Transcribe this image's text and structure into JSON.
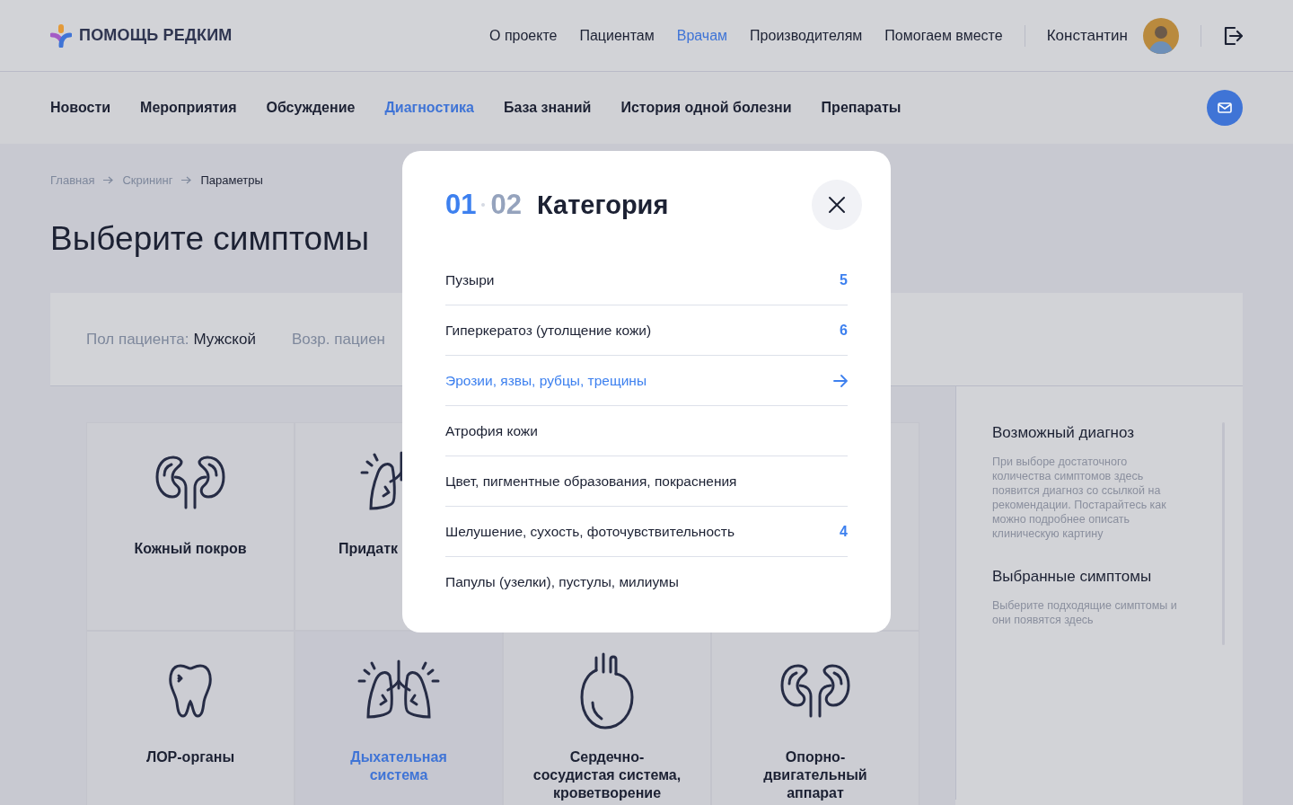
{
  "header": {
    "logo": "ПОМОЩЬ РЕДКИМ",
    "links": [
      {
        "label": "О проекте",
        "selected": false
      },
      {
        "label": "Пациентам",
        "selected": false
      },
      {
        "label": "Врачам",
        "selected": true
      },
      {
        "label": "Производителям",
        "selected": false
      },
      {
        "label": "Помогаем вместе",
        "selected": false
      }
    ],
    "user": "Константин"
  },
  "tabs": [
    {
      "label": "Новости",
      "selected": false
    },
    {
      "label": "Мероприятия",
      "selected": false
    },
    {
      "label": "Обсуждение",
      "selected": false
    },
    {
      "label": "Диагностика",
      "selected": true
    },
    {
      "label": "База знаний",
      "selected": false
    },
    {
      "label": "История одной болезни",
      "selected": false
    },
    {
      "label": "Препараты",
      "selected": false
    }
  ],
  "breadcrumbs": [
    "Главная",
    "Скрининг",
    "Параметры"
  ],
  "title": "Выберите симптомы",
  "filters": [
    {
      "label": "Пол пациента:",
      "value": "Мужской"
    },
    {
      "label": "Возр. пациен"
    }
  ],
  "categories": [
    [
      {
        "label": "Кожный покров",
        "kind": "kidneys",
        "selected": false
      },
      {
        "label": "Придатк",
        "kind": "lung",
        "selected": false
      }
    ],
    [
      {
        "label": "ЛОР-органы",
        "kind": "tooth",
        "selected": false
      },
      {
        "label": "Дыхательная система",
        "kind": "lungs",
        "selected": true
      },
      {
        "label": "Сердечно-сосудистая система, кроветворение",
        "kind": "heart",
        "selected": false
      },
      {
        "label": "Опорно-двигательный аппарат",
        "kind": "kidneys",
        "selected": false
      }
    ]
  ],
  "sidebar": [
    {
      "heading": "Возможный диагноз",
      "text": "При выборе достаточного количества симптомов здесь появится диагноз со ссылкой на рекомендации. Постарайтесь как можно подробнее описать клиническую картину"
    },
    {
      "heading": "Выбранные симптомы",
      "text": "Выберите подходящие симптомы и они появятся здесь"
    }
  ],
  "modal": {
    "step": "01",
    "steps": "02",
    "title": "Категория",
    "items": [
      {
        "label": "Пузыри",
        "count": "5",
        "hovered": false
      },
      {
        "label": "Гиперкератоз (утолщение кожи)",
        "count": "6",
        "hovered": false
      },
      {
        "label": "Эрозии, язвы, рубцы, трещины",
        "hovered": true
      },
      {
        "label": "Атрофия кожи",
        "hovered": false
      },
      {
        "label": "Цвет, пигментные образования, покраснения",
        "hovered": false
      },
      {
        "label": "Шелушение, сухость, фоточувствительность",
        "count": "4",
        "hovered": false
      },
      {
        "label": "Папулы (узелки), пустулы, милиумы",
        "hovered": false
      }
    ]
  }
}
